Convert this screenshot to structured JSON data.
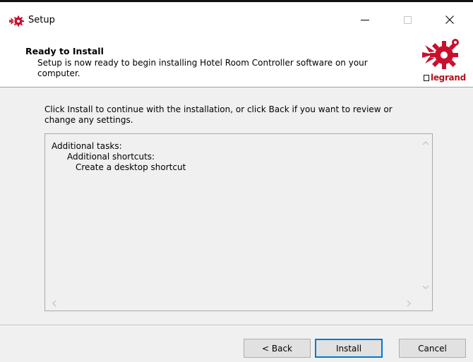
{
  "window": {
    "title": "Setup",
    "controls": [
      "minimize",
      "maximize",
      "close"
    ]
  },
  "header": {
    "title": "Ready to Install",
    "subtitle": "Setup is now ready to begin installing Hotel Room Controller software on your computer.",
    "logo_text": "legrand"
  },
  "main": {
    "intro": "Click Install to continue with the installation, or click Back if you want to review or change any settings.",
    "memo_lines": [
      "Additional tasks:",
      "Additional shortcuts:",
      "Create a desktop shortcut"
    ]
  },
  "buttons": {
    "back": "< Back",
    "install": "Install",
    "cancel": "Cancel"
  },
  "colors": {
    "brand_red": "#c8102e",
    "accent_blue": "#0078d7"
  }
}
